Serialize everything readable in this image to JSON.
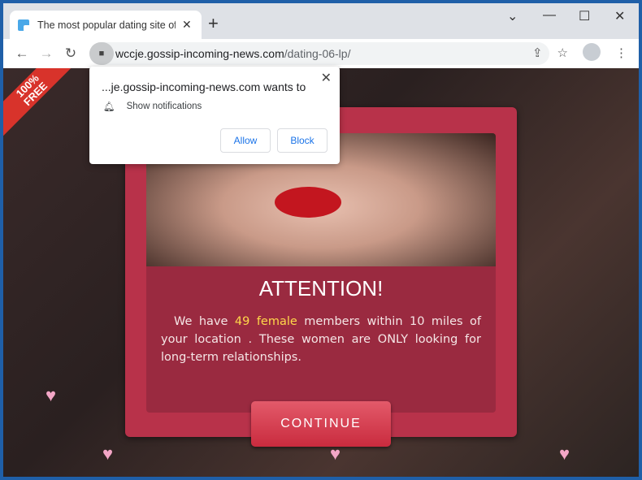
{
  "tab": {
    "title": "The most popular dating site of the",
    "close": "✕",
    "new": "+"
  },
  "window": {
    "minimize": "⌄",
    "min2": "—",
    "max": "☐",
    "close": "✕"
  },
  "nav": {
    "back": "←",
    "forward": "→",
    "reload": "↻"
  },
  "address": {
    "host": "wccje.gossip-incoming-news.com",
    "path": "/dating-06-lp/"
  },
  "popup": {
    "title": "...je.gossip-incoming-news.com wants to",
    "permission": "Show notifications",
    "allow": "Allow",
    "block": "Block",
    "close": "✕"
  },
  "page": {
    "ribbon_line1": "100%",
    "ribbon_line2": "FREE",
    "heading": "ATTENTION!",
    "msg_pre": "We have ",
    "msg_highlight": "49 female",
    "msg_post": " members within 10 miles of your location . These women are ONLY looking for long-term relationships.",
    "continue": "CONTINUE",
    "heart": "♥"
  }
}
